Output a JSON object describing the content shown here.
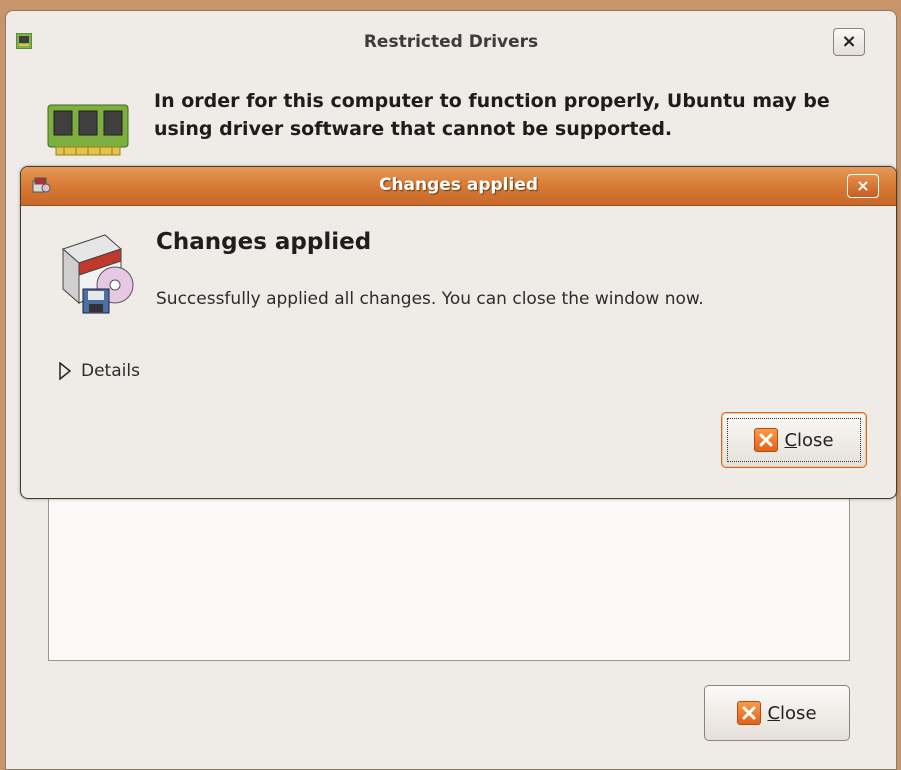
{
  "background_window": {
    "title": "Restricted Drivers",
    "close_glyph": "×",
    "message": "In order for this computer to function properly, Ubuntu may be using driver software that cannot be supported.",
    "close_button_label": "Close",
    "icons": [
      "chip-icon",
      "driver-board-icon",
      "close-x-icon"
    ]
  },
  "dialog": {
    "title": "Changes applied",
    "close_glyph": "×",
    "heading": "Changes applied",
    "message": "Successfully applied all changes. You can close the window now.",
    "details_label": "Details",
    "close_button_label": "Close",
    "icons": [
      "package-install-icon",
      "disclosure-triangle-icon",
      "close-x-icon"
    ]
  },
  "colors": {
    "titlebar_active": "#d77a34",
    "window_bg": "#efebe7",
    "desktop": "#c8956a",
    "close_icon": "#e2621a"
  }
}
